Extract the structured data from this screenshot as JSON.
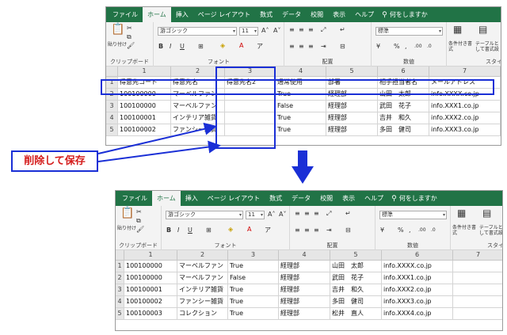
{
  "top": {
    "tabs": [
      "ファイル",
      "ホーム",
      "挿入",
      "ページ レイアウト",
      "数式",
      "データ",
      "校閲",
      "表示",
      "ヘルプ"
    ],
    "active_tab": "ホーム",
    "tell_me": "何をしますか",
    "clipboard": {
      "paste": "貼り付け",
      "label": "クリップボード"
    },
    "font": {
      "name": "游ゴシック",
      "size": "11",
      "label": "フォント"
    },
    "align": {
      "label": "配置"
    },
    "number": {
      "format": "標準",
      "label": "数値"
    },
    "styles": {
      "cond": "条件付き書式",
      "table": "テーブルとして書式設定",
      "label": "スタイ"
    },
    "columns": [
      "1",
      "2",
      "3",
      "4",
      "5",
      "6",
      "7"
    ],
    "rows": [
      {
        "n": "1",
        "c": [
          "得意先コード",
          "得意先名",
          "得意先名2",
          "通常使用",
          "部署",
          "相手担当者名",
          "メールアドレス"
        ]
      },
      {
        "n": "2",
        "c": [
          "100100000",
          "マーベルファン",
          "",
          "True",
          "経理部",
          "山田　太郎",
          "info.XXXX.co.jp"
        ]
      },
      {
        "n": "3",
        "c": [
          "100100000",
          "マーベルファン",
          "",
          "False",
          "経理部",
          "武田　花子",
          "info.XXX1.co.jp"
        ]
      },
      {
        "n": "4",
        "c": [
          "100100001",
          "インテリア雑貨",
          "",
          "True",
          "経理部",
          "吉井　和久",
          "info.XXX2.co.jp"
        ]
      },
      {
        "n": "5",
        "c": [
          "100100002",
          "ファンシー雑貨",
          "",
          "True",
          "経理部",
          "多田　健司",
          "info.XXX3.co.jp"
        ]
      }
    ]
  },
  "bottom": {
    "tabs": [
      "ファイル",
      "ホーム",
      "挿入",
      "ページ レイアウト",
      "数式",
      "データ",
      "校閲",
      "表示",
      "ヘルプ"
    ],
    "active_tab": "ホーム",
    "tell_me": "何をしますか",
    "clipboard": {
      "paste": "貼り付け",
      "label": "クリップボード"
    },
    "font": {
      "name": "游ゴシック",
      "size": "11",
      "label": "フォント"
    },
    "align": {
      "label": "配置"
    },
    "number": {
      "format": "標準",
      "label": "数値"
    },
    "styles": {
      "cond": "条件付き書式",
      "table": "テーブルとして書式設定",
      "label": "スタイ"
    },
    "columns": [
      "1",
      "2",
      "3",
      "4",
      "5",
      "6",
      "7"
    ],
    "rows": [
      {
        "n": "1",
        "c": [
          "100100000",
          "マーベルファン",
          "True",
          "経理部",
          "山田　太郎",
          "info.XXXX.co.jp",
          ""
        ]
      },
      {
        "n": "2",
        "c": [
          "100100000",
          "マーベルファン",
          "False",
          "経理部",
          "武田　花子",
          "info.XXX1.co.jp",
          ""
        ]
      },
      {
        "n": "3",
        "c": [
          "100100001",
          "インテリア雑貨",
          "True",
          "経理部",
          "吉井　和久",
          "info.XXX2.co.jp",
          ""
        ]
      },
      {
        "n": "4",
        "c": [
          "100100002",
          "ファンシー雑貨",
          "True",
          "経理部",
          "多田　健司",
          "info.XXX3.co.jp",
          ""
        ]
      },
      {
        "n": "5",
        "c": [
          "100100003",
          "コレクション",
          "True",
          "経理部",
          "松井　直人",
          "info.XXX4.co.jp",
          ""
        ]
      }
    ]
  },
  "callout": "削除して保存",
  "colors": {
    "excel_green": "#217346",
    "highlight_blue": "#1a2fd6",
    "callout_red": "#d41c1c"
  }
}
